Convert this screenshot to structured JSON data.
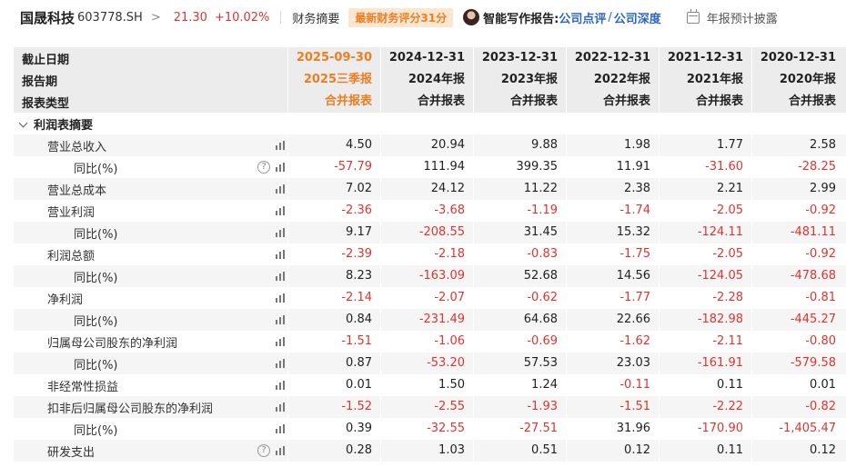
{
  "header": {
    "stock_name": "国晟科技",
    "stock_code": "603778.SH",
    "chevron": ">",
    "price": "21.30",
    "change_pct": "+10.02%",
    "tab_summary": "财务摘要",
    "score_badge": "最新财务评分31分",
    "ai_label": "智能写作报告:",
    "ai_link_review": "公司点评",
    "ai_slash": "/",
    "ai_link_depth": "公司深度",
    "forecast_label": "年报预计披露",
    "colors": {
      "up": "#e2332e",
      "highlight": "#ef7d21",
      "link": "#2d67c7",
      "badge_bg": "#fde6cf"
    }
  },
  "table": {
    "header_rows": [
      {
        "label": "截止日期",
        "cells": [
          "2025-09-30",
          "2024-12-31",
          "2023-12-31",
          "2022-12-31",
          "2021-12-31",
          "2020-12-31"
        ]
      },
      {
        "label": "报告期",
        "cells": [
          "2025三季报",
          "2024年报",
          "2023年报",
          "2022年报",
          "2021年报",
          "2020年报"
        ]
      },
      {
        "label": "报表类型",
        "cells": [
          "合并报表",
          "合并报表",
          "合并报表",
          "合并报表",
          "合并报表",
          "合并报表"
        ]
      }
    ],
    "section_title": "利润表摘要",
    "rows": [
      {
        "label": "营业总收入",
        "level": 1,
        "help": false,
        "values": [
          "4.50",
          "20.94",
          "9.88",
          "1.98",
          "1.77",
          "2.58"
        ]
      },
      {
        "label": "同比(%)",
        "level": 2,
        "help": true,
        "values": [
          "-57.79",
          "111.94",
          "399.35",
          "11.91",
          "-31.60",
          "-28.25"
        ]
      },
      {
        "label": "营业总成本",
        "level": 1,
        "help": false,
        "values": [
          "7.02",
          "24.12",
          "11.22",
          "2.38",
          "2.21",
          "2.99"
        ]
      },
      {
        "label": "营业利润",
        "level": 1,
        "help": false,
        "values": [
          "-2.36",
          "-3.68",
          "-1.19",
          "-1.74",
          "-2.05",
          "-0.92"
        ]
      },
      {
        "label": "同比(%)",
        "level": 2,
        "help": false,
        "values": [
          "9.17",
          "-208.55",
          "31.45",
          "15.32",
          "-124.11",
          "-481.11"
        ]
      },
      {
        "label": "利润总额",
        "level": 1,
        "help": false,
        "values": [
          "-2.39",
          "-2.18",
          "-0.83",
          "-1.75",
          "-2.05",
          "-0.92"
        ]
      },
      {
        "label": "同比(%)",
        "level": 2,
        "help": false,
        "values": [
          "8.23",
          "-163.09",
          "52.68",
          "14.56",
          "-124.05",
          "-478.68"
        ]
      },
      {
        "label": "净利润",
        "level": 1,
        "help": false,
        "values": [
          "-2.14",
          "-2.07",
          "-0.62",
          "-1.77",
          "-2.28",
          "-0.81"
        ]
      },
      {
        "label": "同比(%)",
        "level": 2,
        "help": false,
        "values": [
          "0.84",
          "-231.49",
          "64.68",
          "22.66",
          "-182.98",
          "-445.27"
        ]
      },
      {
        "label": "归属母公司股东的净利润",
        "level": 1,
        "help": false,
        "values": [
          "-1.51",
          "-1.06",
          "-0.69",
          "-1.62",
          "-2.11",
          "-0.80"
        ]
      },
      {
        "label": "同比(%)",
        "level": 2,
        "help": false,
        "values": [
          "0.87",
          "-53.20",
          "57.53",
          "23.03",
          "-161.91",
          "-579.58"
        ]
      },
      {
        "label": "非经常性损益",
        "level": 1,
        "help": false,
        "values": [
          "0.01",
          "1.50",
          "1.24",
          "-0.11",
          "0.11",
          "0.01"
        ]
      },
      {
        "label": "扣非后归属母公司股东的净利润",
        "level": 1,
        "help": false,
        "values": [
          "-1.52",
          "-2.55",
          "-1.93",
          "-1.51",
          "-2.22",
          "-0.82"
        ]
      },
      {
        "label": "同比(%)",
        "level": 2,
        "help": false,
        "values": [
          "0.39",
          "-32.55",
          "-27.51",
          "31.96",
          "-170.90",
          "-1,405.47"
        ]
      },
      {
        "label": "研发支出",
        "level": 1,
        "help": true,
        "values": [
          "0.28",
          "1.03",
          "0.51",
          "0.12",
          "0.11",
          "0.12"
        ]
      }
    ]
  },
  "icons": {
    "chart": "bar-chart-icon",
    "help": "question-circle-icon",
    "help_glyph": "?",
    "collapse": "chevron-down-icon",
    "calendar": "calendar-icon"
  }
}
